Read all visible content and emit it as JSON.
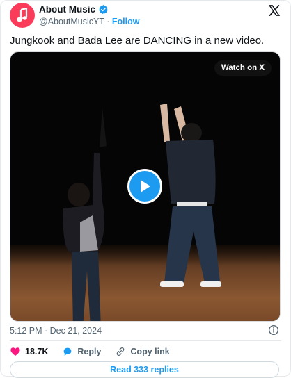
{
  "author": {
    "name": "About Music",
    "handle": "@AboutMusicYT",
    "separator": "·",
    "follow_label": "Follow"
  },
  "tweet": {
    "text": "Jungkook and Bada Lee are DANCING in a new video.",
    "timestamp": "5:12 PM · Dec 21, 2024"
  },
  "media": {
    "watch_label": "Watch on X"
  },
  "actions": {
    "likes_count": "18.7K",
    "reply_label": "Reply",
    "copy_link_label": "Copy link"
  },
  "read_replies_label": "Read 333 replies",
  "colors": {
    "accent": "#1d9bf0",
    "like": "#f91880",
    "avatar_bg": "#fb3b5a"
  },
  "icons": [
    "music-note-icon",
    "verified-badge-icon",
    "x-logo-icon",
    "play-icon",
    "info-icon",
    "heart-icon",
    "reply-icon",
    "link-icon"
  ]
}
